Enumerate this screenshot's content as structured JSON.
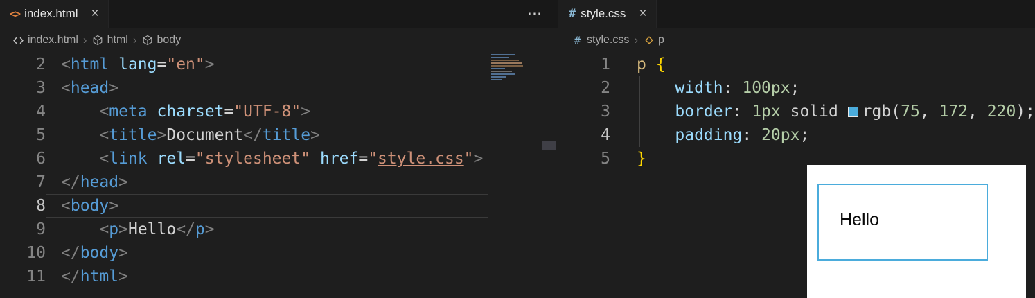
{
  "icons": {
    "html_file": "<>",
    "css_file": "#",
    "more_actions": "⋯",
    "close": "×",
    "breadcrumb_separator": "›"
  },
  "left_editor": {
    "tab": {
      "label": "index.html"
    },
    "breadcrumbs": [
      {
        "icon": "code-icon",
        "label": "index.html"
      },
      {
        "icon": "symbol-cube-icon",
        "label": "html"
      },
      {
        "icon": "symbol-cube-icon",
        "label": "body"
      }
    ],
    "lines": [
      {
        "num": "2",
        "tokens": [
          {
            "t": "<",
            "c": "punct"
          },
          {
            "t": "html",
            "c": "tag"
          },
          {
            "t": " ",
            "c": "pln"
          },
          {
            "t": "lang",
            "c": "attr"
          },
          {
            "t": "=",
            "c": "pln"
          },
          {
            "t": "\"en\"",
            "c": "str"
          },
          {
            "t": ">",
            "c": "punct"
          }
        ]
      },
      {
        "num": "3",
        "tokens": [
          {
            "t": "<",
            "c": "punct"
          },
          {
            "t": "head",
            "c": "tag"
          },
          {
            "t": ">",
            "c": "punct"
          }
        ]
      },
      {
        "num": "4",
        "guide": true,
        "tokens": [
          {
            "t": "    ",
            "c": "pln"
          },
          {
            "t": "<",
            "c": "punct"
          },
          {
            "t": "meta",
            "c": "tag"
          },
          {
            "t": " ",
            "c": "pln"
          },
          {
            "t": "charset",
            "c": "attr"
          },
          {
            "t": "=",
            "c": "pln"
          },
          {
            "t": "\"UTF-8\"",
            "c": "str"
          },
          {
            "t": ">",
            "c": "punct"
          }
        ]
      },
      {
        "num": "5",
        "guide": true,
        "tokens": [
          {
            "t": "    ",
            "c": "pln"
          },
          {
            "t": "<",
            "c": "punct"
          },
          {
            "t": "title",
            "c": "tag"
          },
          {
            "t": ">",
            "c": "punct"
          },
          {
            "t": "Document",
            "c": "pln"
          },
          {
            "t": "</",
            "c": "punct"
          },
          {
            "t": "title",
            "c": "tag"
          },
          {
            "t": ">",
            "c": "punct"
          }
        ]
      },
      {
        "num": "6",
        "guide": true,
        "tokens": [
          {
            "t": "    ",
            "c": "pln"
          },
          {
            "t": "<",
            "c": "punct"
          },
          {
            "t": "link",
            "c": "tag"
          },
          {
            "t": " ",
            "c": "pln"
          },
          {
            "t": "rel",
            "c": "attr"
          },
          {
            "t": "=",
            "c": "pln"
          },
          {
            "t": "\"stylesheet\"",
            "c": "str"
          },
          {
            "t": " ",
            "c": "pln"
          },
          {
            "t": "href",
            "c": "attr"
          },
          {
            "t": "=",
            "c": "pln"
          },
          {
            "t": "\"",
            "c": "str"
          },
          {
            "t": "style.css",
            "c": "link"
          },
          {
            "t": "\"",
            "c": "str"
          },
          {
            "t": ">",
            "c": "punct"
          }
        ]
      },
      {
        "num": "7",
        "tokens": [
          {
            "t": "</",
            "c": "punct"
          },
          {
            "t": "head",
            "c": "tag"
          },
          {
            "t": ">",
            "c": "punct"
          }
        ]
      },
      {
        "num": "8",
        "current": true,
        "border": true,
        "tokens": [
          {
            "t": "<",
            "c": "punct"
          },
          {
            "t": "body",
            "c": "tag"
          },
          {
            "t": ">",
            "c": "punct"
          }
        ]
      },
      {
        "num": "9",
        "guide": true,
        "tokens": [
          {
            "t": "    ",
            "c": "pln"
          },
          {
            "t": "<",
            "c": "punct"
          },
          {
            "t": "p",
            "c": "tag"
          },
          {
            "t": ">",
            "c": "punct"
          },
          {
            "t": "Hello",
            "c": "pln"
          },
          {
            "t": "</",
            "c": "punct"
          },
          {
            "t": "p",
            "c": "tag"
          },
          {
            "t": ">",
            "c": "punct"
          }
        ]
      },
      {
        "num": "10",
        "tokens": [
          {
            "t": "</",
            "c": "punct"
          },
          {
            "t": "body",
            "c": "tag"
          },
          {
            "t": ">",
            "c": "punct"
          }
        ]
      },
      {
        "num": "11",
        "tokens": [
          {
            "t": "</",
            "c": "punct"
          },
          {
            "t": "html",
            "c": "tag"
          },
          {
            "t": ">",
            "c": "punct"
          }
        ]
      }
    ]
  },
  "right_editor": {
    "tab": {
      "label": "style.css"
    },
    "breadcrumbs": [
      {
        "icon": "hash-icon",
        "label": "style.css"
      },
      {
        "icon": "css-selector-icon",
        "label": "p"
      }
    ],
    "lines": [
      {
        "num": "1",
        "tokens": [
          {
            "t": "p",
            "c": "sel"
          },
          {
            "t": " ",
            "c": "pln"
          },
          {
            "t": "{",
            "c": "brace"
          }
        ]
      },
      {
        "num": "2",
        "guide": true,
        "tokens": [
          {
            "t": "    ",
            "c": "pln"
          },
          {
            "t": "width",
            "c": "prop"
          },
          {
            "t": ":",
            "c": "pln"
          },
          {
            "t": " ",
            "c": "pln"
          },
          {
            "t": "100px",
            "c": "num"
          },
          {
            "t": ";",
            "c": "pln"
          }
        ]
      },
      {
        "num": "3",
        "guide": true,
        "tokens": [
          {
            "t": "    ",
            "c": "pln"
          },
          {
            "t": "border",
            "c": "prop"
          },
          {
            "t": ":",
            "c": "pln"
          },
          {
            "t": " ",
            "c": "pln"
          },
          {
            "t": "1px",
            "c": "num"
          },
          {
            "t": " solid ",
            "c": "pln"
          },
          {
            "c": "swatch",
            "color": "#4bacdc"
          },
          {
            "t": "rgb",
            "c": "pln"
          },
          {
            "t": "(",
            "c": "pln"
          },
          {
            "t": "75",
            "c": "num"
          },
          {
            "t": ", ",
            "c": "pln"
          },
          {
            "t": "172",
            "c": "num"
          },
          {
            "t": ", ",
            "c": "pln"
          },
          {
            "t": "220",
            "c": "num"
          },
          {
            "t": ")",
            "c": "pln"
          },
          {
            "t": ";",
            "c": "pln"
          }
        ]
      },
      {
        "num": "4",
        "guide": true,
        "current": true,
        "tokens": [
          {
            "t": "    ",
            "c": "pln"
          },
          {
            "t": "padding",
            "c": "prop"
          },
          {
            "t": ":",
            "c": "pln"
          },
          {
            "t": " ",
            "c": "pln"
          },
          {
            "t": "20px",
            "c": "num"
          },
          {
            "t": ";",
            "c": "pln"
          }
        ]
      },
      {
        "num": "5",
        "tokens": [
          {
            "t": "}",
            "c": "brace"
          }
        ]
      }
    ]
  },
  "preview": {
    "paragraph_text": "Hello",
    "border_color": "#4bacdc"
  }
}
